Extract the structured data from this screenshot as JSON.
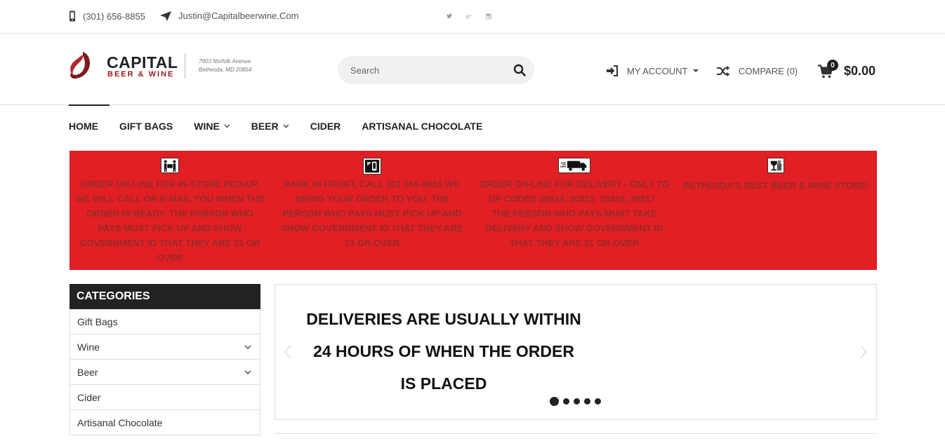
{
  "topbar": {
    "phone": "(301) 656-8855",
    "email": "Justin@Capitalbeerwine.Com",
    "social": [
      "twitter-icon",
      "google-plus-icon",
      "instagram-icon"
    ]
  },
  "logo": {
    "title": "CAPITAL",
    "subtitle": "BEER & WINE",
    "address_line1": "7903 Norfolk Avenue",
    "address_line2": "Bethesda, MD 20854"
  },
  "search": {
    "placeholder": "Search"
  },
  "account": {
    "label": "MY ACCOUNT"
  },
  "compare": {
    "label": "COMPARE (0)"
  },
  "cart": {
    "count": "0",
    "total": "$0.00"
  },
  "nav": {
    "items": [
      {
        "label": "HOME"
      },
      {
        "label": "GIFT BAGS"
      },
      {
        "label": "WINE"
      },
      {
        "label": "BEER"
      },
      {
        "label": "CIDER"
      },
      {
        "label": "ARTISANAL CHOCOLATE"
      }
    ]
  },
  "banner": {
    "color": "#e21f23",
    "items": [
      {
        "icon": "pickup-icon",
        "text": "ORDER ON-LINE FOR IN-STORE PICKUP. WE WILL CALL OR E-MAIL YOU WHEN THE ORDER IS READY. THE PERSON WHO PAYS MUST PICK UP AND SHOW GOVERNMENT ID THAT THEY ARE 21 OR OVER"
      },
      {
        "icon": "parking-icon",
        "text": "PARK IN FRONT, CALL 301 656-8855 WE BRING YOUR ORDER TO YOU. THE PERSON WHO PAYS MUST PICK UP AND SHOW GOVERNMENT ID THAT THEY ARE 21 OR OVER"
      },
      {
        "icon": "delivery-truck-icon",
        "text": "ORDER ON-LINE FOR DELIVERY - ONLY TO ZIP CODES 20814, 20815, 20816, 20817 - THE PERSON WHO PAYS MUST TAKE DELIVERY AND SHOW GOVERNMENT ID THAT THEY ARE 21 OR OVER"
      },
      {
        "icon": "store-icon",
        "text": "BETHESDA'S BEST BEER & WINE STORE!"
      }
    ]
  },
  "categories": {
    "title": "CATEGORIES",
    "items": [
      {
        "label": "Gift Bags"
      },
      {
        "label": "Wine"
      },
      {
        "label": "Beer"
      },
      {
        "label": "Cider"
      },
      {
        "label": "Artisanal Chocolate"
      }
    ]
  },
  "slider": {
    "lines": [
      "DELIVERIES ARE USUALLY WITHIN",
      "24 HOURS OF WHEN THE ORDER",
      "IS PLACED"
    ],
    "slide_count": 5,
    "active_slide": 1
  }
}
